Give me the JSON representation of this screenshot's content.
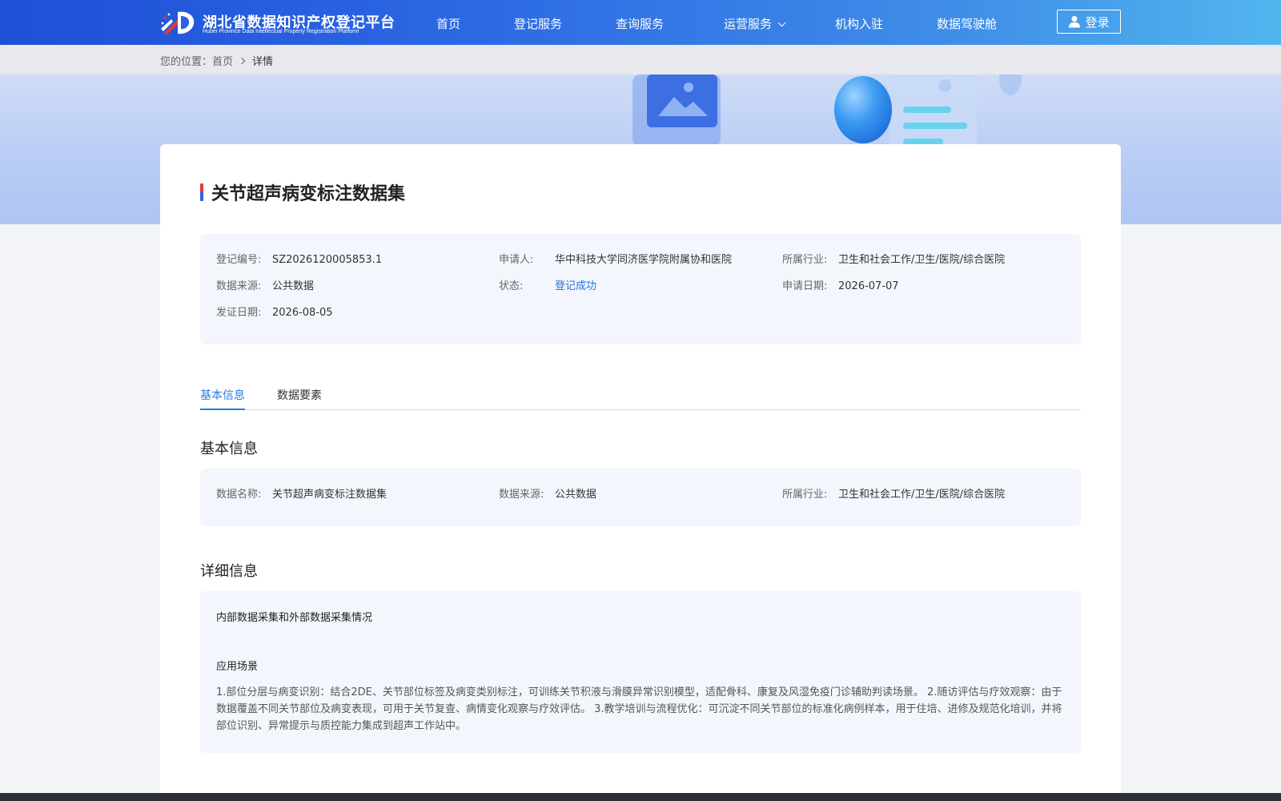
{
  "header": {
    "logo_title": "湖北省数据知识产权登记平台",
    "logo_subtitle": "Hubei Province Data Intellectual Property Registration Platform",
    "nav": [
      {
        "label": "首页"
      },
      {
        "label": "登记服务"
      },
      {
        "label": "查询服务"
      },
      {
        "label": "运营服务"
      },
      {
        "label": "机构入驻"
      },
      {
        "label": "数据驾驶舱"
      }
    ],
    "login_label": "登录",
    "icons": {
      "dropdown": "chevron-down-icon",
      "login": "user-icon"
    }
  },
  "breadcrumb": {
    "prefix": "您的位置：",
    "home": "首页",
    "current": "详情"
  },
  "detail": {
    "title": "关节超声病变标注数据集",
    "summary": {
      "reg_no_label": "登记编号:",
      "reg_no": "SZ2026120005853.1",
      "applicant_label": "申请人:",
      "applicant": "华中科技大学同济医学院附属协和医院",
      "industry_label": "所属行业:",
      "industry": "卫生和社会工作/卫生/医院/综合医院",
      "source_label": "数据来源:",
      "source": "公共数据",
      "status_label": "状态:",
      "status": "登记成功",
      "apply_date_label": "申请日期:",
      "apply_date": "2026-07-07",
      "issue_date_label": "发证日期:",
      "issue_date": "2026-08-05"
    },
    "tabs": [
      {
        "label": "基本信息",
        "active": true
      },
      {
        "label": "数据要素",
        "active": false
      }
    ],
    "basic": {
      "section_title": "基本信息",
      "name_label": "数据名称:",
      "name": "关节超声病变标注数据集",
      "source_label": "数据来源:",
      "source": "公共数据",
      "industry_label": "所属行业:",
      "industry": "卫生和社会工作/卫生/医院/综合医院"
    },
    "more": {
      "section_title": "详细信息",
      "collect_head": "内部数据采集和外部数据采集情况",
      "scene_head": "应用场景",
      "scene_text": "1.部位分层与病变识别：结合2DE、关节部位标签及病变类别标注，可训练关节积液与滑膜异常识别模型，适配骨科、康复及风湿免疫门诊辅助判读场景。 2.随访评估与疗效观察：由于数据覆盖不同关节部位及病变表现，可用于关节复查、病情变化观察与疗效评估。 3.教学培训与流程优化：可沉淀不同关节部位的标准化病例样本，用于住培、进修及规范化培训，并将部位识别、异常提示与质控能力集成到超声工作站中。"
    }
  },
  "colors": {
    "header_start": "#1f4fd6",
    "header_end": "#52b6ee",
    "accent": "#2a7ae8",
    "status_ok": "#2a6fe0",
    "panel_bg": "#f3f6fc"
  }
}
